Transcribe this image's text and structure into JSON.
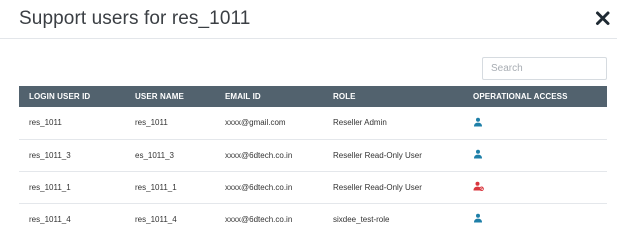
{
  "modal": {
    "title": "Support users for res_1011"
  },
  "search": {
    "placeholder": "Search",
    "value": ""
  },
  "table": {
    "columns": [
      "LOGIN USER ID",
      "USER NAME",
      "EMAIL ID",
      "ROLE",
      "OPERATIONAL ACCESS"
    ],
    "rows": [
      {
        "login_user_id": "res_1011",
        "user_name": "res_1011",
        "email_id": "xxxx@gmail.com",
        "role": "Reseller Admin",
        "access_icon": "user-icon",
        "access_state": "enabled"
      },
      {
        "login_user_id": "res_1011_3",
        "user_name": "es_1011_3",
        "email_id": "xxxx@6dtech.co.in",
        "role": "Reseller Read-Only User",
        "access_icon": "user-icon",
        "access_state": "enabled"
      },
      {
        "login_user_id": "res_1011_1",
        "user_name": "res_1011_1",
        "email_id": "xxxx@6dtech.co.in",
        "role": "Reseller Read-Only User",
        "access_icon": "user-blocked-icon",
        "access_state": "disabled"
      },
      {
        "login_user_id": "res_1011_4",
        "user_name": "res_1011_4",
        "email_id": "xxxx@6dtech.co.in",
        "role": "sixdee_test-role",
        "access_icon": "user-icon",
        "access_state": "enabled"
      }
    ]
  },
  "colors": {
    "header_bg": "#52626e",
    "access_enabled": "#1e7fa8",
    "access_disabled": "#d9363e",
    "title_text": "#3b3f44"
  }
}
